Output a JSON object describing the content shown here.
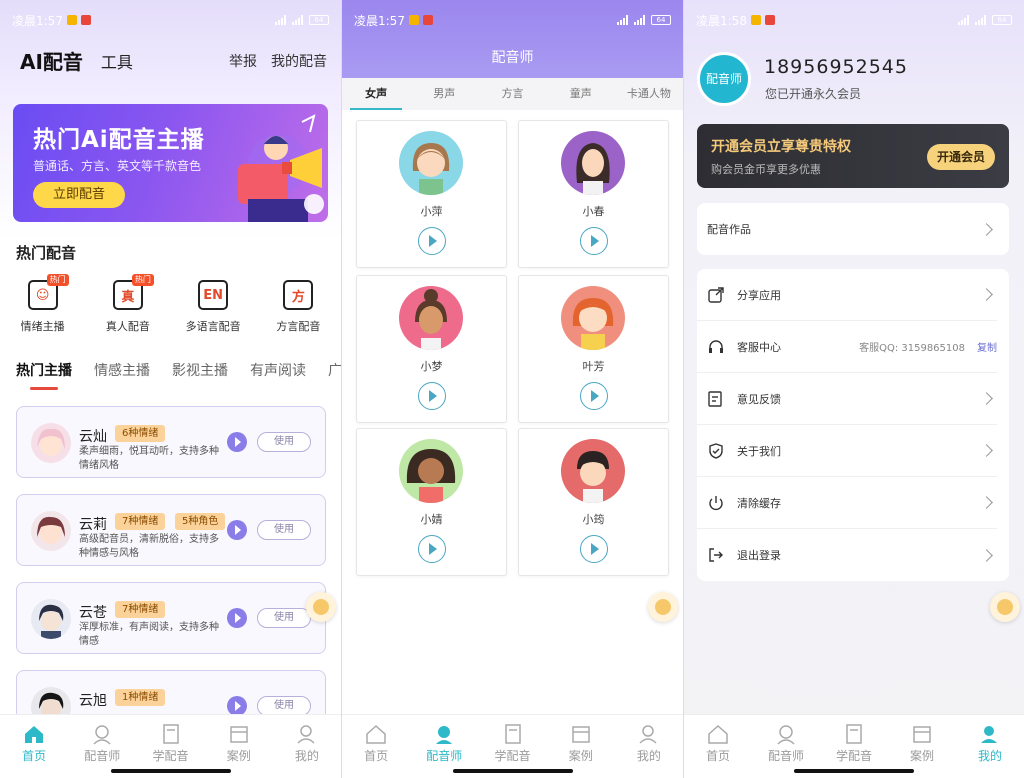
{
  "status": {
    "p1_time": "凌晨1:57",
    "p2_time": "凌晨1:57",
    "p3_time": "凌晨1:58",
    "battery": "64"
  },
  "nav": {
    "items": [
      "首页",
      "配音师",
      "学配音",
      "案例",
      "我的"
    ]
  },
  "p1": {
    "brand": "AI配音",
    "tool": "工具",
    "report": "举报",
    "my_dubbing": "我的配音",
    "banner": {
      "title": "热门Ai配音主播",
      "subtitle": "普通话、方言、英文等千款音色",
      "button": "立即配音"
    },
    "hot_title": "热门配音",
    "hot_badge": "热门",
    "quick": [
      {
        "glyph": "☺",
        "label": "情绪主播"
      },
      {
        "glyph": "真",
        "label": "真人配音"
      },
      {
        "glyph": "EN",
        "label": "多语言配音"
      },
      {
        "glyph": "方",
        "label": "方言配音"
      }
    ],
    "tabs": [
      "热门主播",
      "情感主播",
      "影视主播",
      "有声阅读",
      "广告"
    ],
    "use_label": "使用",
    "anchors": [
      {
        "name": "云灿",
        "tags": [
          "6种情绪"
        ],
        "desc": "柔声细雨，悦耳动听，支持多种情绪风格"
      },
      {
        "name": "云莉",
        "tags": [
          "7种情绪",
          "5种角色"
        ],
        "desc": "高级配音员，清新脱俗，支持多种情感与风格"
      },
      {
        "name": "云苍",
        "tags": [
          "7种情绪"
        ],
        "desc": "浑厚标准，有声阅读，支持多种情感"
      },
      {
        "name": "云旭",
        "tags": [
          "1种情绪"
        ],
        "desc": ""
      }
    ]
  },
  "p2": {
    "title": "配音师",
    "tabs": [
      "女声",
      "男声",
      "方言",
      "童声",
      "卡通人物"
    ],
    "voices": [
      "小萍",
      "小春",
      "小梦",
      "叶芳",
      "小婧",
      "小筠"
    ]
  },
  "p3": {
    "avatar_text": "配音师",
    "phone": "18956952545",
    "member_status": "您已开通永久会员",
    "vip": {
      "title": "开通会员立享尊贵特权",
      "subtitle": "购会员金币享更多优惠",
      "button": "开通会员"
    },
    "works": "配音作品",
    "menu": {
      "share": "分享应用",
      "service": "客服中心",
      "service_qq": "客服QQ: 3159865108",
      "copy": "复制",
      "feedback": "意见反馈",
      "about": "关于我们",
      "cache": "清除缓存",
      "logout": "退出登录"
    }
  },
  "colors": {
    "accent": "#2db9c8",
    "purple": "#9b87ee",
    "gold": "#f6d27d"
  }
}
